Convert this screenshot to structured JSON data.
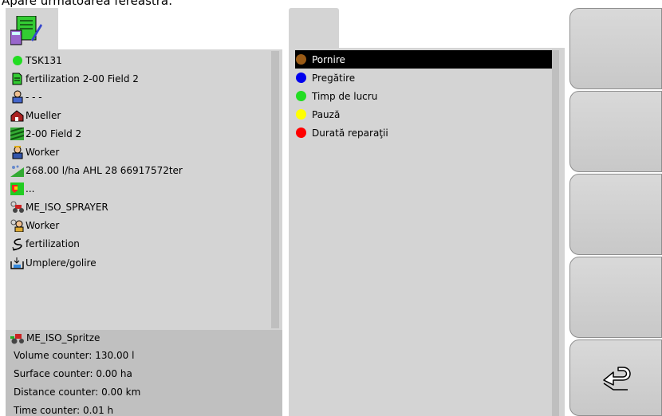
{
  "caption": "Apare următoarea fereastră:",
  "left": {
    "items": [
      {
        "icon": "green-dot-icon",
        "label": "TSK131"
      },
      {
        "icon": "document-icon",
        "label": "fertilization 2-00 Field 2"
      },
      {
        "icon": "customer-icon",
        "label": "- - -"
      },
      {
        "icon": "farm-icon",
        "label": "Mueller"
      },
      {
        "icon": "field-icon",
        "label": "2-00 Field 2"
      },
      {
        "icon": "worker-icon",
        "label": "Worker"
      },
      {
        "icon": "product-icon",
        "label": "268.00 l/ha AHL 28 66917572ter"
      },
      {
        "icon": "map-icon",
        "label": "..."
      },
      {
        "icon": "machine-icon",
        "label": "ME_ISO_SPRAYER"
      },
      {
        "icon": "worker-gear-icon",
        "label": "Worker"
      },
      {
        "icon": "operation-icon",
        "label": "fertilization"
      },
      {
        "icon": "fill-empty-icon",
        "label": "Umplere/golire"
      }
    ],
    "device": "ME_ISO_Spritze",
    "counters": [
      "Volume counter: 130.00 l",
      "Surface counter: 0.00 ha",
      "Distance counter: 0.00 km",
      "Time counter: 0.01 h"
    ]
  },
  "middle": {
    "items": [
      {
        "label": "Pornire",
        "color": "#9a5b16",
        "selected": true
      },
      {
        "label": "Pregătire",
        "color": "#0000ee",
        "selected": false
      },
      {
        "label": "Timp de lucru",
        "color": "#22dd22",
        "selected": false
      },
      {
        "label": "Pauză",
        "color": "#ffff00",
        "selected": false
      },
      {
        "label": "Durată reparaţii",
        "color": "#ff0000",
        "selected": false
      }
    ]
  },
  "right_buttons": [
    "",
    "",
    "",
    "",
    "back-arrow-icon"
  ]
}
